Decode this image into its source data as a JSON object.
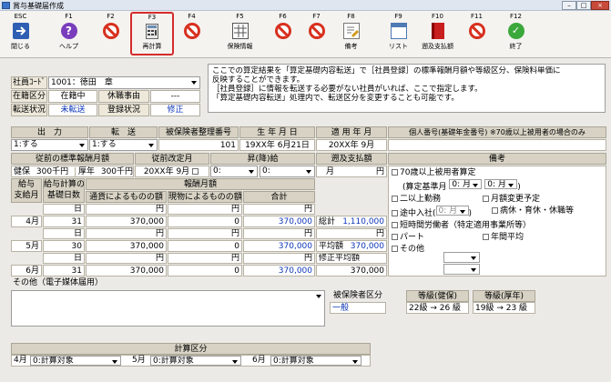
{
  "window": {
    "title": "賞与基礎届作成"
  },
  "toolbar": {
    "buttons": [
      {
        "key": "ESC",
        "label": "閉じる"
      },
      {
        "key": "F1",
        "label": "ヘルプ"
      },
      {
        "key": "F2",
        "label": ""
      },
      {
        "key": "F3",
        "label": "再計算"
      },
      {
        "key": "F4",
        "label": ""
      },
      {
        "key": "F5",
        "label": "保険情報"
      },
      {
        "key": "F6",
        "label": ""
      },
      {
        "key": "F7",
        "label": ""
      },
      {
        "key": "F8",
        "label": "備考"
      },
      {
        "key": "F9",
        "label": "リスト"
      },
      {
        "key": "F10",
        "label": "遡及支払額"
      },
      {
        "key": "F11",
        "label": ""
      },
      {
        "key": "F12",
        "label": "終了"
      }
    ]
  },
  "employee": {
    "code_label": "社員ｺｰﾄﾞ",
    "code_value": "1001：徳田　章",
    "enroll_label": "在籍区分",
    "enroll_value": "在籍中",
    "leave_label": "休職事由",
    "leave_value": "---",
    "transfer_label": "転送状況",
    "transfer_value": "未転送",
    "reg_label": "登録状況",
    "reg_value": "修正"
  },
  "note": "ここでの算定結果を「算定基礎内容転送」で［社員登録］の標準報酬月額や等級区分、保険料単価に\n反映することができます。\n［社員登録］に情報を転送する必要がない社員がいれば、ここで指定します。\n「算定基礎内容転送」処理内で、転送区分を変更することも可能です。",
  "head1": {
    "output_label": "出　力",
    "output_value": "1:する",
    "transfer_label": "転　送",
    "transfer_value": "1:する",
    "insured_label": "被保険者整理番号",
    "insured_value": "101",
    "birth_label": "生 年 月 日",
    "birth_value": "19XX年 6月21日",
    "apply_label": "適 用 年 月",
    "apply_value": "20XX年 9月",
    "mynumber_label": "個人番号(基礎年金番号) ※70歳以上被用者の場合のみ"
  },
  "head2": {
    "prev_label": "従前の標準報酬月額",
    "prev_kenpo_label": "健保",
    "prev_kenpo_value": "300",
    "prev_kenpo_unit": "千円",
    "prev_kosei_label": "厚年",
    "prev_kosei_value": "300",
    "prev_kosei_unit": "千円",
    "revise_label": "従前改定月",
    "revise_value": "20XX年 9月",
    "updown_label": "昇(降)給",
    "updown_month": "0:",
    "updown_dir": "0:",
    "retro_label": "遡及支払額",
    "retro_unit": "月",
    "retro_yen": "円",
    "remarks_label": "備考"
  },
  "table": {
    "pay_month_label": "給与\n支給月",
    "days_label": "給与計算の\n基礎日数",
    "monthly_label": "報酬月額",
    "currency_label": "通貨によるものの額",
    "kind_label": "現物によるものの額",
    "sum_label": "合計",
    "day_unit": "日",
    "yen_unit": "円",
    "rows": [
      {
        "month": "4月",
        "days": "31",
        "currency": "370,000",
        "kind": "0",
        "total": "370,000"
      },
      {
        "month": "5月",
        "days": "30",
        "currency": "370,000",
        "kind": "0",
        "total": "370,000"
      },
      {
        "month": "6月",
        "days": "31",
        "currency": "370,000",
        "kind": "0",
        "total": "370,000"
      }
    ],
    "total_label": "総計",
    "total_value": "1,110,000",
    "avg_label": "平均額",
    "avg_value": "370,000",
    "adj_avg_label": "修正平均額",
    "adj_avg_value": "370,000"
  },
  "remarks": {
    "over70": "70歳以上被用者算定",
    "calc_month_label": "(算定基準月",
    "calc_m1": "0: 月",
    "calc_m2": "0: 月",
    "calc_close": ")",
    "two_plus": "二以上勤務",
    "monthly_change": "月額変更予定",
    "midway": "途中入社(",
    "midway_value": "0: 月",
    "midway_close": ")",
    "sick": "病休・育休・休職等",
    "short_time": "短時間労働者（特定適用事業所等）",
    "part": "パート",
    "annual_avg": "年間平均",
    "other": "その他"
  },
  "bottom": {
    "other_label": "その他（電子媒体届用）",
    "insured_type_label": "被保険者区分",
    "insured_type_value": "一般",
    "grade_kenpo_label": "等級(健保)",
    "grade_kenpo_value": "22級 → 26 級",
    "grade_kosei_label": "等級(厚年)",
    "grade_kosei_value": "19級 → 23 級"
  },
  "calc": {
    "title": "計算区分",
    "m4_label": "4月",
    "m4_value": "0:計算対象",
    "m5_label": "5月",
    "m5_value": "0:計算対象",
    "m6_label": "6月",
    "m6_value": "0:計算対象"
  }
}
